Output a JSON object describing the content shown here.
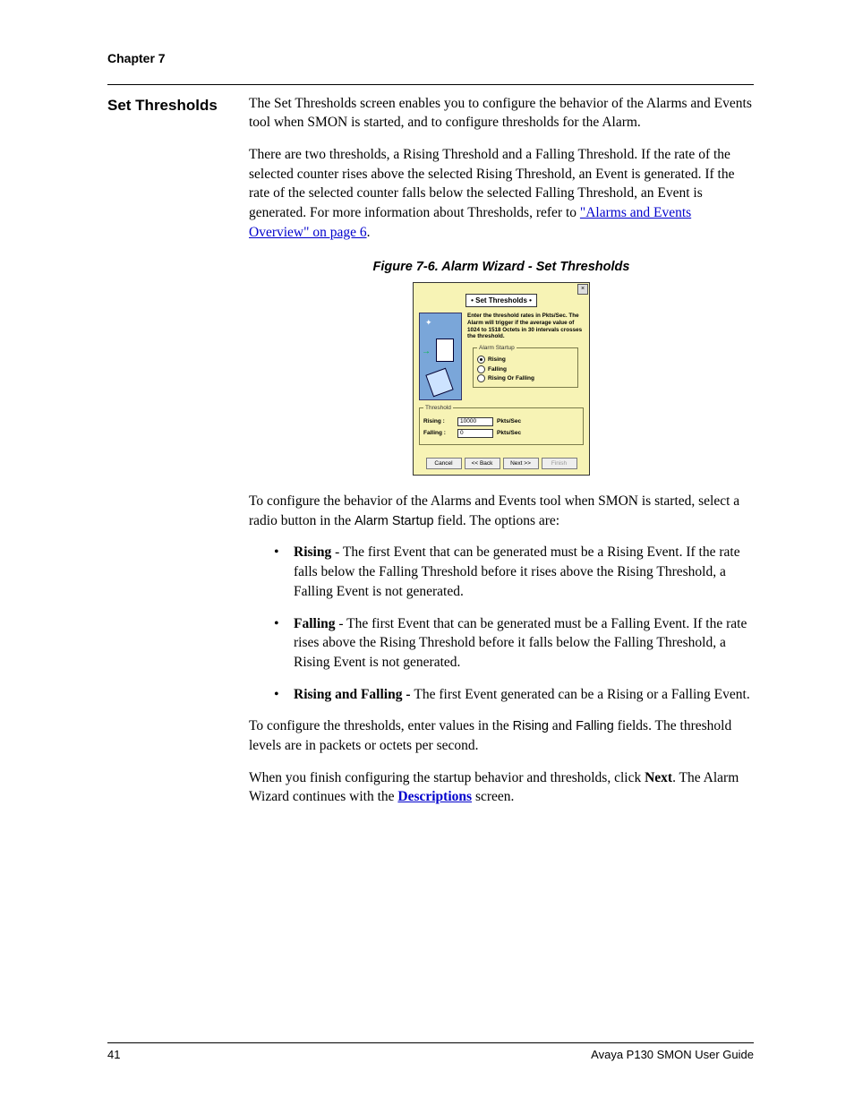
{
  "header": {
    "chapter": "Chapter 7"
  },
  "section": {
    "heading": "Set Thresholds"
  },
  "paragraphs": {
    "intro1": "The Set Thresholds screen enables you to configure the behavior of the Alarms and Events tool when SMON is started, and to configure thresholds for the Alarm.",
    "intro2_pre": "There are two thresholds, a Rising Threshold and a Falling Threshold. If the rate of the selected counter rises above the selected Rising Threshold, an Event is generated. If the rate of the selected counter falls below the selected Falling Threshold, an Event is generated. For more information about Thresholds, refer to ",
    "intro2_link": "\"Alarms and Events Overview\" on page 6",
    "intro2_post": ".",
    "after_fig_a": "To configure the behavior of the Alarms and Events tool when SMON is started, select a radio button in the ",
    "after_fig_b": "Alarm Startup",
    "after_fig_c": " field. The options are:",
    "thr_a": "To configure the thresholds, enter values in the ",
    "thr_b": "Rising",
    "thr_c": " and ",
    "thr_d": "Falling",
    "thr_e": " fields. The threshold levels are in packets or octets per second.",
    "next_a": "When you finish configuring the startup behavior and thresholds, click ",
    "next_b": "Next",
    "next_c": ". The Alarm Wizard continues with the ",
    "next_link": "Descriptions",
    "next_d": " screen."
  },
  "figure": {
    "caption": "Figure 7-6.  Alarm Wizard - Set Thresholds"
  },
  "wizard": {
    "title": "• Set Thresholds •",
    "close": "×",
    "desc": "Enter the threshold rates in Pkts/Sec. The Alarm will trigger if the average value of 1024 to 1518 Octets in 30 intervals crosses the threshold.",
    "startup_legend": "Alarm Startup",
    "radios": {
      "rising": "Rising",
      "falling": "Falling",
      "both": "Rising Or Falling"
    },
    "threshold_legend": "Threshold",
    "rows": {
      "rising_label": "Rising :",
      "rising_value": "10000",
      "falling_label": "Falling :",
      "falling_value": "0",
      "unit": "Pkts/Sec"
    },
    "buttons": {
      "cancel": "Cancel",
      "back": "<< Back",
      "next": "Next >>",
      "finish": "Finish"
    }
  },
  "bullets": {
    "rising_h": "Rising",
    "rising_t": " - The first Event that can be generated must be a Rising Event. If the rate falls below the Falling Threshold before it rises above the Rising Threshold, a Falling Event is not generated.",
    "falling_h": "Falling",
    "falling_t": " - The first Event that can be generated must be a Falling Event. If the rate rises above the Rising Threshold before it falls below the Falling Threshold, a Rising Event is not generated.",
    "both_h": "Rising and Falling - ",
    "both_t": "The first Event generated can be a Rising or a Falling Event."
  },
  "footer": {
    "page": "41",
    "doc": "Avaya P130 SMON User Guide"
  }
}
